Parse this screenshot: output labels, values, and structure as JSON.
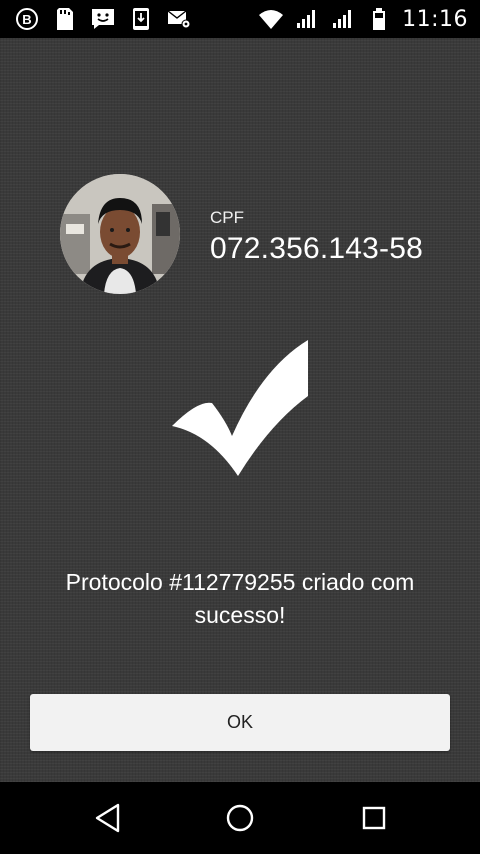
{
  "status_bar": {
    "time": "11:16",
    "left_icons": [
      "b-circle-icon",
      "sd-card-icon",
      "chat-smile-icon",
      "download-phone-icon",
      "mail-gear-icon"
    ],
    "right_icons": [
      "wifi-icon",
      "signal-icon",
      "signal-icon",
      "battery-icon"
    ]
  },
  "user": {
    "cpf_label": "CPF",
    "cpf_value": "072.356.143-58"
  },
  "message": "Protocolo #112779255 criado com sucesso!",
  "ok_button_label": "OK",
  "navbar": {
    "buttons": [
      "back-icon",
      "home-icon",
      "recents-icon"
    ]
  },
  "colors": {
    "background": "#3a3a3a",
    "button_bg": "#f2f2f2",
    "text": "#ffffff"
  }
}
